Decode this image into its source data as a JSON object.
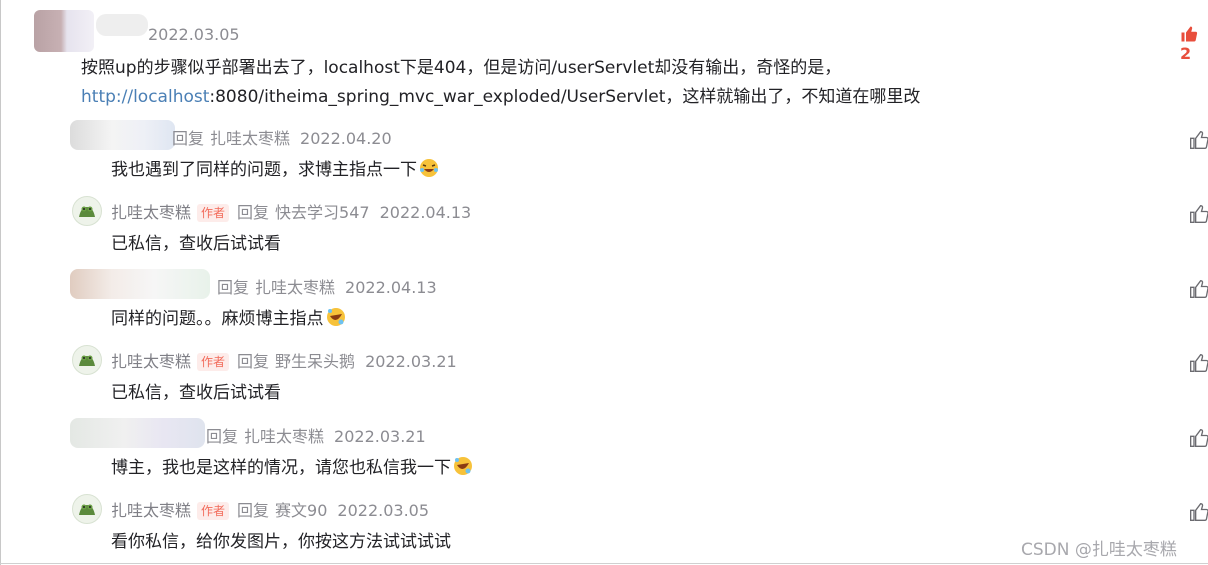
{
  "top_comment": {
    "date": "2022.03.05",
    "like_count": "2",
    "text_line1": "按照up的步骤似乎部署出去了，localhost下是404，但是访问/userServlet却没有输出，奇怪的是，",
    "link_text": "http://localhost",
    "text_line2_rest": ":8080/itheima_spring_mvc_war_exploded/UserServlet，这样就输出了，不知道在哪里改"
  },
  "reply_label": "回复",
  "author_tag": "作者",
  "replies": [
    {
      "user": "",
      "target": "扎哇太枣糕",
      "date": "2022.04.20",
      "text": "我也遇到了同样的问题，求博主指点一下",
      "emoji": "laugh-cry-emoji"
    },
    {
      "user": "扎哇太枣糕",
      "target": "快去学习547",
      "date": "2022.04.13",
      "text": "已私信，查收后试试看"
    },
    {
      "user": "",
      "target": "扎哇太枣糕",
      "date": "2022.04.13",
      "text": "同样的问题。。麻烦博主指点",
      "emoji": "rolling-laugh-emoji"
    },
    {
      "user": "扎哇太枣糕",
      "target": "野生呆头鹅",
      "date": "2022.03.21",
      "text": "已私信，查收后试试看"
    },
    {
      "user": "",
      "target": "扎哇太枣糕",
      "date": "2022.03.21",
      "text": "博主，我也是这样的情况，请您也私信我一下",
      "emoji": "rolling-laugh-emoji"
    },
    {
      "user": "扎哇太枣糕",
      "target": "赛文90",
      "date": "2022.03.05",
      "text": "看你私信，给你发图片，你按这方法试试试试"
    }
  ],
  "watermark": "CSDN @扎哇太枣糕",
  "colors": {
    "link": "#4a7fb5",
    "author_tag": "#f26b5b",
    "like_active": "#e84e3c",
    "meta": "#8c8c92"
  }
}
